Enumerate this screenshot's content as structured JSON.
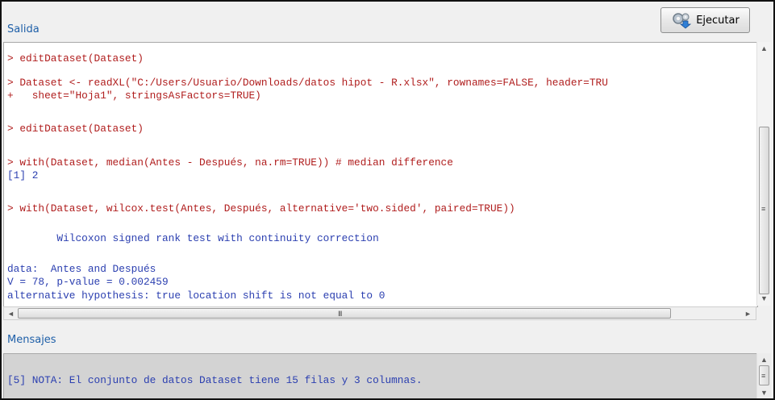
{
  "output_section": {
    "label": "Salida",
    "run_button_label": "Ejecutar",
    "lines": [
      {
        "kind": "cmd",
        "text": "> editDataset(Dataset)"
      },
      {
        "kind": "cmd",
        "text": "> Dataset <- readXL(\"C:/Users/Usuario/Downloads/datos hipot - R.xlsx\", rownames=FALSE, header=TRU"
      },
      {
        "kind": "cmd",
        "text": "+   sheet=\"Hoja1\", stringsAsFactors=TRUE)"
      },
      {
        "kind": "cmd",
        "text": "> editDataset(Dataset)"
      },
      {
        "kind": "cmd",
        "text": "> with(Dataset, median(Antes - Después, na.rm=TRUE)) # median difference"
      },
      {
        "kind": "res",
        "text": "[1] 2"
      },
      {
        "kind": "cmd",
        "text": "> with(Dataset, wilcox.test(Antes, Después, alternative='two.sided', paired=TRUE))"
      },
      {
        "kind": "res",
        "text": "        Wilcoxon signed rank test with continuity correction"
      },
      {
        "kind": "res",
        "text": "data:  Antes and Después"
      },
      {
        "kind": "res",
        "text": "V = 78, p-value = 0.002459"
      },
      {
        "kind": "res",
        "text": "alternative hypothesis: true location shift is not equal to 0"
      }
    ]
  },
  "messages_section": {
    "label": "Mensajes",
    "lines": [
      {
        "kind": "res",
        "text": "[5] NOTA: El conjunto de datos Dataset tiene 15 filas y 3 columnas."
      }
    ]
  },
  "scrollbar_glyphs": {
    "up": "▲",
    "down": "▼",
    "left": "◄",
    "right": "►",
    "grip": "≡",
    "hgrip": "III"
  },
  "colors": {
    "command": "#b01d1d",
    "result": "#2b3fb0",
    "section_label": "#1e5fa8"
  }
}
